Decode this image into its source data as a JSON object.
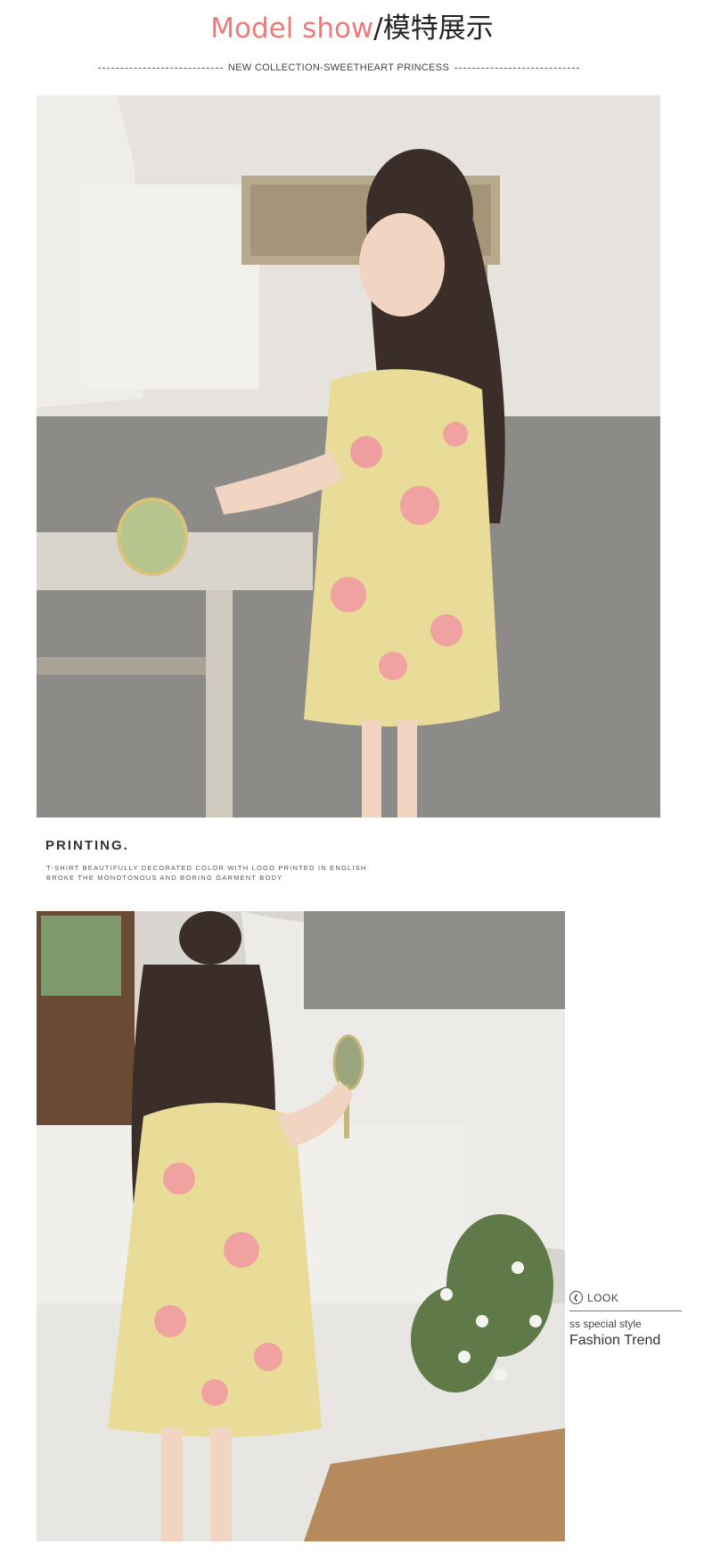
{
  "header": {
    "title_en": "Model show",
    "title_sep": "/",
    "title_cn": "模特展示",
    "subtitle": "NEW COLLECTION-SWEETHEART PRINCESS",
    "accent_color": "#f07a7a"
  },
  "printing": {
    "title": "PRINTING.",
    "line1": "T-SHIRT BEAUTIFULLY DECORATED COLOR WITH LOGO PRINTED IN ENGLISH",
    "line2": "BROKE THE MONOTONOUS AND BORING GARMENT BODY"
  },
  "side_label": {
    "look_icon": "chevron-left-icon",
    "look": "LOOK",
    "small": "ss special style",
    "big": "Fashion Trend"
  },
  "photos": {
    "photo1_desc": "model-photo-1",
    "photo2_desc": "model-photo-2",
    "dress_color": "#e9dc98",
    "flower_color": "#f08fa3"
  }
}
